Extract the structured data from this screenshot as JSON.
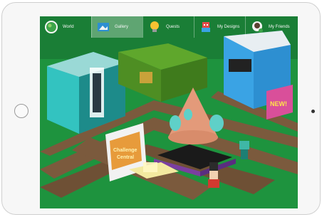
{
  "nav": {
    "items": [
      {
        "label": "World",
        "icon": "globe-icon"
      },
      {
        "label": "Gallery",
        "icon": "gallery-icon"
      },
      {
        "label": "Quests",
        "icon": "lightbulb-icon"
      },
      {
        "label": "My Designs",
        "icon": "robot-icon"
      },
      {
        "label": "My Friends",
        "icon": "friends-icon"
      }
    ],
    "active_index": 1
  },
  "signs": {
    "challenge_line1": "Challenge",
    "challenge_line2": "Central",
    "new_badge": "NEW!"
  },
  "colors": {
    "grass": "#1d8f3c",
    "path": "#7a5b3e",
    "accent_building": "#2fb8b4",
    "rocket": "#e49a78"
  }
}
